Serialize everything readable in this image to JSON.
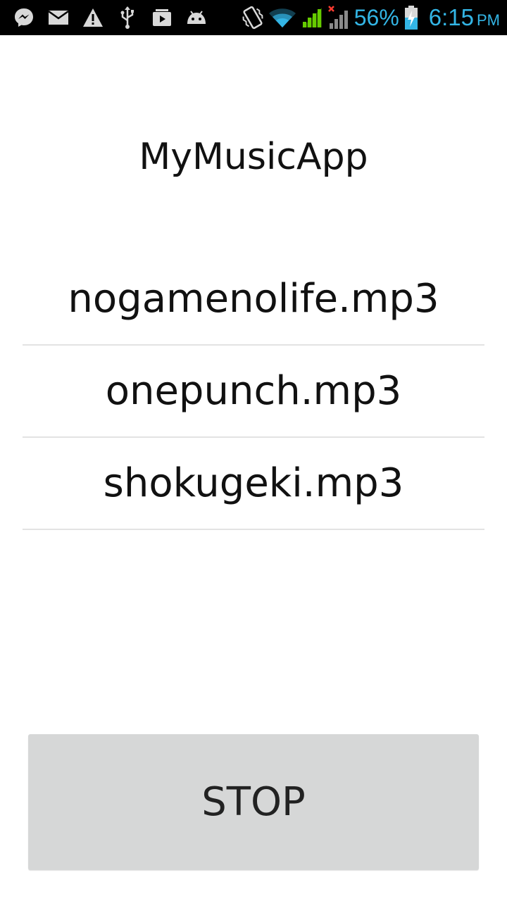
{
  "status_bar": {
    "left_icons": [
      "messenger-icon",
      "mail-icon",
      "warning-icon",
      "usb-icon",
      "media-icon",
      "android-debug-icon"
    ],
    "right_icons": [
      "vibrate-icon",
      "wifi-icon",
      "signal-icon",
      "signal-no-sim-icon",
      "battery-charging-icon"
    ],
    "battery_percent": "56%",
    "time": "6:15",
    "ampm": "PM",
    "accent_color": "#33b5e5",
    "signal_color": "#66cc00"
  },
  "app": {
    "title": "MyMusicApp"
  },
  "songs": [
    {
      "label": "nogamenolife.mp3"
    },
    {
      "label": "onepunch.mp3"
    },
    {
      "label": "shokugeki.mp3"
    }
  ],
  "controls": {
    "stop_label": "STOP"
  }
}
